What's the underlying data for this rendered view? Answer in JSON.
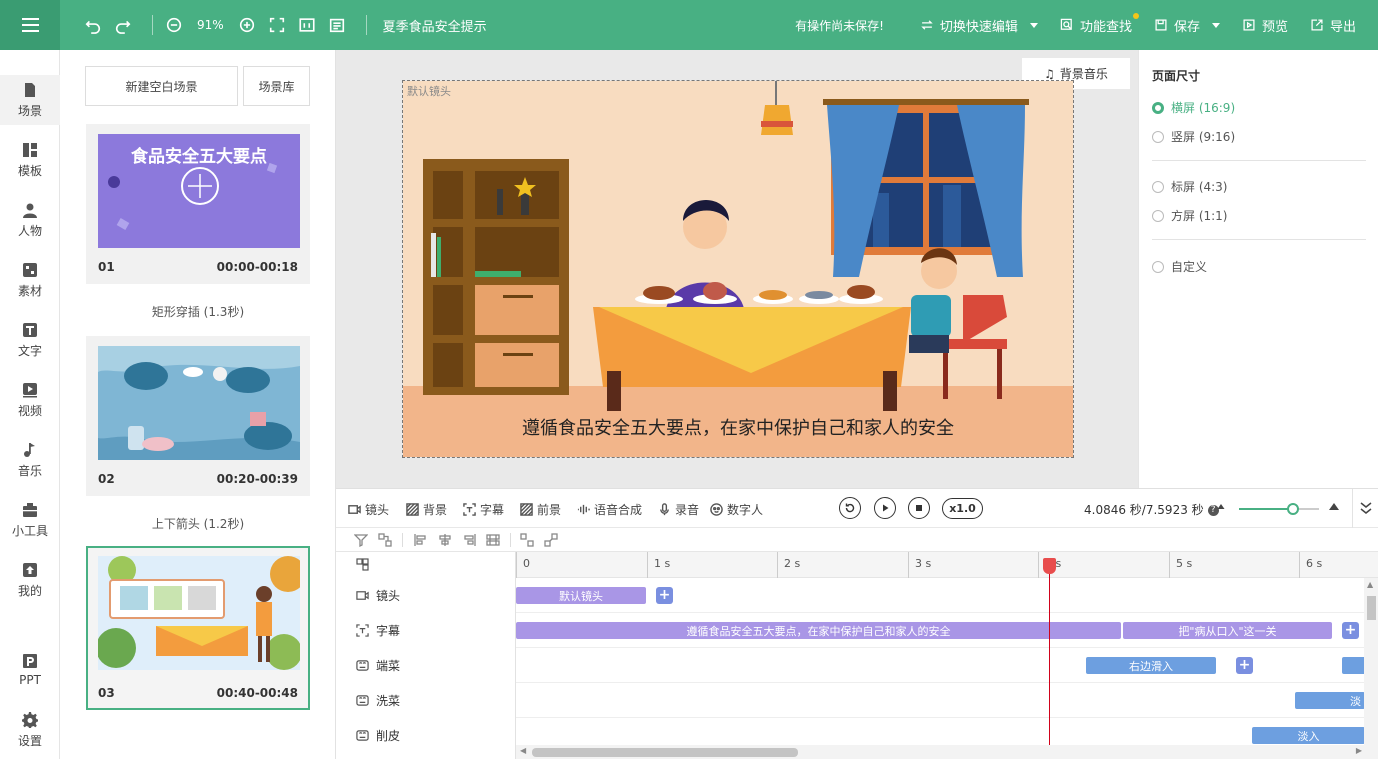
{
  "topbar": {
    "zoom": "91%",
    "project_title": "夏季食品安全提示",
    "unsaved_status": "有操作尚未保存!",
    "switch_edit": "切换快速编辑",
    "feature_search": "功能查找",
    "save": "保存",
    "preview": "预览",
    "export": "导出"
  },
  "nav": {
    "scene": "场景",
    "template": "模板",
    "character": "人物",
    "material": "素材",
    "text": "文字",
    "video": "视频",
    "music": "音乐",
    "tools": "小工具",
    "mine": "我的",
    "ppt": "PPT",
    "settings": "设置"
  },
  "scenes": {
    "new_blank": "新建空白场景",
    "library": "场景库",
    "items": [
      {
        "num": "01",
        "time": "00:00-00:18",
        "thumb_title": "食品安全五大要点"
      },
      {
        "num": "02",
        "time": "00:20-00:39"
      },
      {
        "num": "03",
        "time": "00:40-00:48"
      }
    ],
    "transitions": [
      "矩形穿插 (1.3秒)",
      "上下箭头 (1.2秒)"
    ]
  },
  "canvas": {
    "bgm": "背景音乐",
    "camera_label": "默认镜头",
    "subtitle": "遵循食品安全五大要点，在家中保护自己和家人的安全"
  },
  "page_size": {
    "title": "页面尺寸",
    "options": [
      "横屏 (16:9)",
      "竖屏 (9:16)",
      "标屏 (4:3)",
      "方屏 (1:1)",
      "自定义"
    ],
    "selected": "横屏 (16:9)"
  },
  "timeline": {
    "tabs": [
      "镜头",
      "背景",
      "字幕",
      "前景",
      "语音合成",
      "录音",
      "数字人"
    ],
    "active_tab": "字幕",
    "speed": "x1.0",
    "time_readout": "4.0846 秒/7.5923 秒",
    "ruler": [
      "0",
      "1 s",
      "2 s",
      "3 s",
      "4 s",
      "5 s",
      "6 s"
    ],
    "playhead_seconds": 4.0846,
    "zoom_fraction": 0.67,
    "tracks": [
      {
        "label": "镜头",
        "icon": "camera-icon",
        "clips": [
          {
            "text": "默认镜头",
            "color": "purple"
          }
        ]
      },
      {
        "label": "字幕",
        "icon": "subtitle-icon",
        "clips": [
          {
            "text": "遵循食品安全五大要点，在家中保护自己和家人的安全",
            "color": "purple"
          },
          {
            "text": "把\"病从口入\"这一关",
            "color": "purple"
          }
        ]
      },
      {
        "label": "端菜",
        "icon": "character-icon",
        "clips": [
          {
            "text": "右边滑入",
            "color": "blue"
          },
          {
            "text": "",
            "color": "blue"
          }
        ]
      },
      {
        "label": "洗菜",
        "icon": "character-icon",
        "clips": [
          {
            "text": "淡",
            "color": "blue"
          }
        ]
      },
      {
        "label": "削皮",
        "icon": "character-icon",
        "clips": [
          {
            "text": "淡入",
            "color": "blue"
          }
        ]
      }
    ]
  },
  "colors": {
    "brand": "#48b083",
    "clip_purple": "#a996e6",
    "clip_blue": "#6d9fe0",
    "playhead": "#d0021b"
  }
}
